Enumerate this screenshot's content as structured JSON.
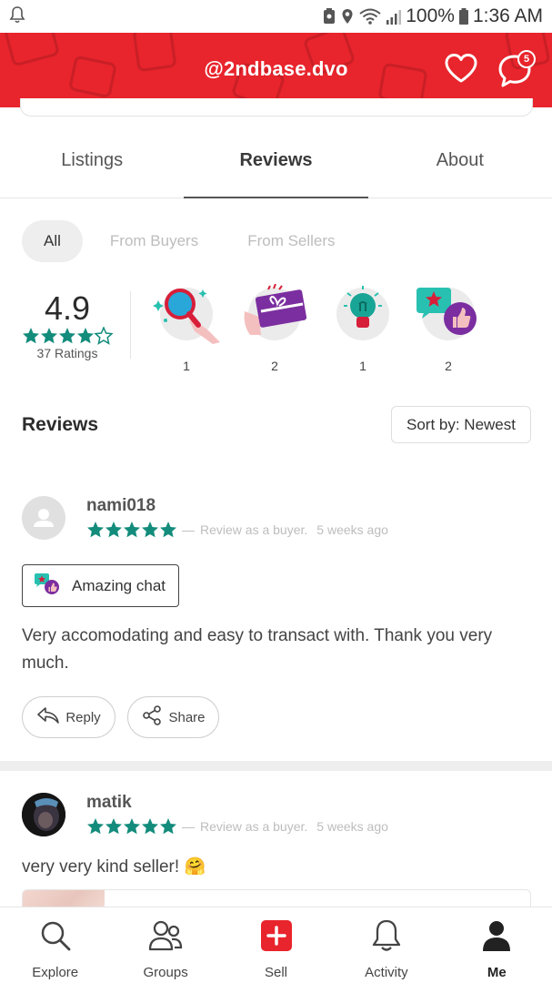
{
  "status_bar": {
    "battery": "100%",
    "time": "1:36 AM"
  },
  "header": {
    "title": "@2ndbase.dvo",
    "chat_badge_count": "5",
    "brand_color": "#e8242c"
  },
  "tabs": [
    {
      "label": "Listings",
      "active": false
    },
    {
      "label": "Reviews",
      "active": true
    },
    {
      "label": "About",
      "active": false
    }
  ],
  "filters": [
    {
      "label": "All",
      "active": true
    },
    {
      "label": "From Buyers",
      "active": false
    },
    {
      "label": "From Sellers",
      "active": false
    }
  ],
  "rating_summary": {
    "score": "4.9",
    "stars_filled": 4.5,
    "ratings_label": "37 Ratings"
  },
  "badges": [
    {
      "icon": "magnifier-hand-icon",
      "count": "1"
    },
    {
      "icon": "gift-card-icon",
      "count": "2"
    },
    {
      "icon": "lightbulb-icon",
      "count": "1"
    },
    {
      "icon": "chat-thumbs-up-icon",
      "count": "2"
    }
  ],
  "reviews_section": {
    "title": "Reviews",
    "sort_label": "Sort by: Newest"
  },
  "reviews": [
    {
      "username": "nami018",
      "stars": 5,
      "dash": "—",
      "role": "Review as a buyer.",
      "time": "5 weeks ago",
      "chip": "Amazing chat",
      "text": "Very accomodating and easy to transact with. Thank you very much.",
      "reply_label": "Reply",
      "share_label": "Share"
    },
    {
      "username": "matik",
      "stars": 5,
      "dash": "—",
      "role": "Review as a buyer.",
      "time": "5 weeks ago",
      "text": "very very kind seller! 🤗"
    }
  ],
  "bottom_nav": [
    {
      "label": "Explore",
      "icon": "search-icon"
    },
    {
      "label": "Groups",
      "icon": "groups-icon"
    },
    {
      "label": "Sell",
      "icon": "plus-icon"
    },
    {
      "label": "Activity",
      "icon": "bell-icon"
    },
    {
      "label": "Me",
      "icon": "profile-icon",
      "active": true
    }
  ],
  "colors": {
    "star_green": "#138c7c",
    "brand_red": "#e8242c"
  }
}
